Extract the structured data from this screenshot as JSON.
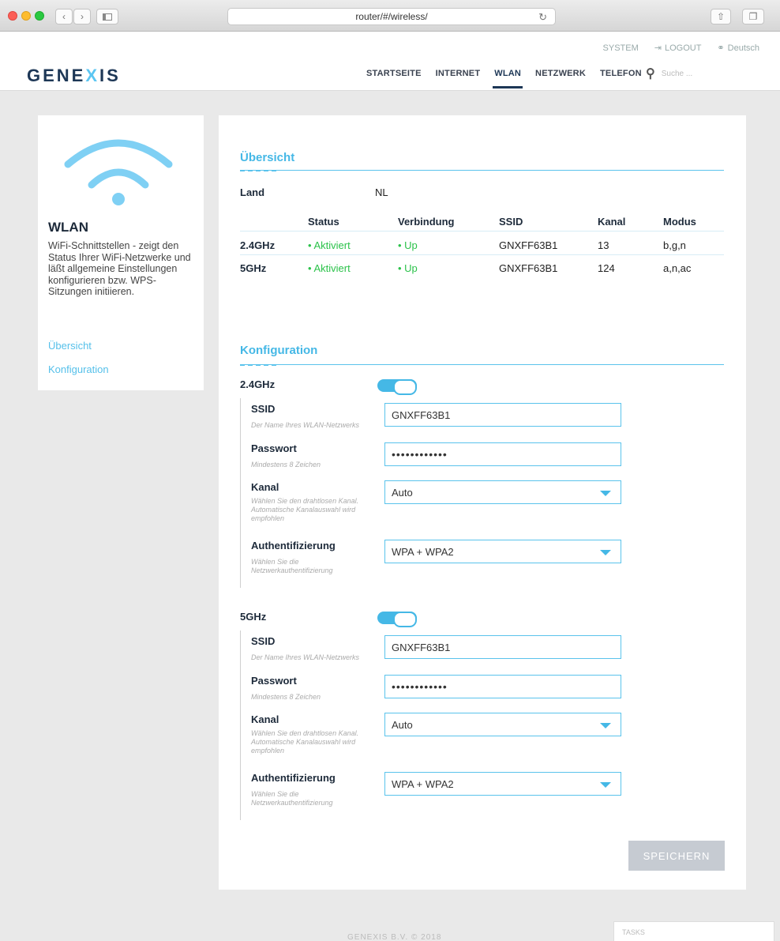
{
  "browser": {
    "url": "router/#/wireless/"
  },
  "header": {
    "logo": {
      "pre": "GENE",
      "x": "X",
      "post": "IS"
    },
    "top_links": {
      "system": "SYSTEM",
      "logout": "LOGOUT",
      "language": "Deutsch"
    },
    "nav": [
      "STARTSEITE",
      "INTERNET",
      "WLAN",
      "NETZWERK",
      "TELEFON"
    ],
    "search_placeholder": "Suche ..."
  },
  "sidebar": {
    "title": "WLAN",
    "description": "WiFi-Schnittstellen - zeigt den Status Ihrer WiFi-Netzwerke und läßt allgemeine Einstellungen konfigurieren bzw. WPS-Sitzungen initiieren.",
    "links": [
      "Übersicht",
      "Konfiguration"
    ]
  },
  "overview": {
    "heading": "Übersicht",
    "land_label": "Land",
    "land_value": "NL",
    "columns": [
      "Status",
      "Verbindung",
      "SSID",
      "Kanal",
      "Modus"
    ],
    "rows": [
      {
        "band": "2.4GHz",
        "status": "Aktiviert",
        "connection": "Up",
        "ssid": "GNXFF63B1",
        "channel": "13",
        "mode": "b,g,n"
      },
      {
        "band": "5GHz",
        "status": "Aktiviert",
        "connection": "Up",
        "ssid": "GNXFF63B1",
        "channel": "124",
        "mode": "a,n,ac"
      }
    ]
  },
  "config": {
    "heading": "Konfiguration",
    "bands": [
      {
        "name": "2.4GHz",
        "enabled": true,
        "ssid_label": "SSID",
        "ssid_help": "Der Name Ihres WLAN-Netzwerks",
        "ssid_value": "GNXFF63B1",
        "pw_label": "Passwort",
        "pw_help": "Mindestens 8 Zeichen",
        "pw_value": "••••••••••••",
        "channel_label": "Kanal",
        "channel_help": "Wählen Sie den drahtlosen Kanal. Automatische Kanalauswahl wird empfohlen",
        "channel_value": "Auto",
        "auth_label": "Authentifizierung",
        "auth_help": "Wählen Sie die Netzwerkauthentifizierung",
        "auth_value": "WPA + WPA2"
      },
      {
        "name": "5GHz",
        "enabled": true,
        "ssid_label": "SSID",
        "ssid_help": "Der Name Ihres WLAN-Netzwerks",
        "ssid_value": "GNXFF63B1",
        "pw_label": "Passwort",
        "pw_help": "Mindestens 8 Zeichen",
        "pw_value": "••••••••••••",
        "channel_label": "Kanal",
        "channel_help": "Wählen Sie den drahtlosen Kanal. Automatische Kanalauswahl wird empfohlen",
        "channel_value": "Auto",
        "auth_label": "Authentifizierung",
        "auth_help": "Wählen Sie die Netzwerkauthentifizierung",
        "auth_value": "WPA + WPA2"
      }
    ],
    "save_label": "SPEICHERN"
  },
  "footer": {
    "copyright": "GENEXIS B.V. © 2018",
    "tasks": "TASKS"
  },
  "colors": {
    "accent": "#45b8e6",
    "navy": "#1d3756",
    "green": "#2bc24a",
    "save_disabled": "#c6cbd2"
  }
}
